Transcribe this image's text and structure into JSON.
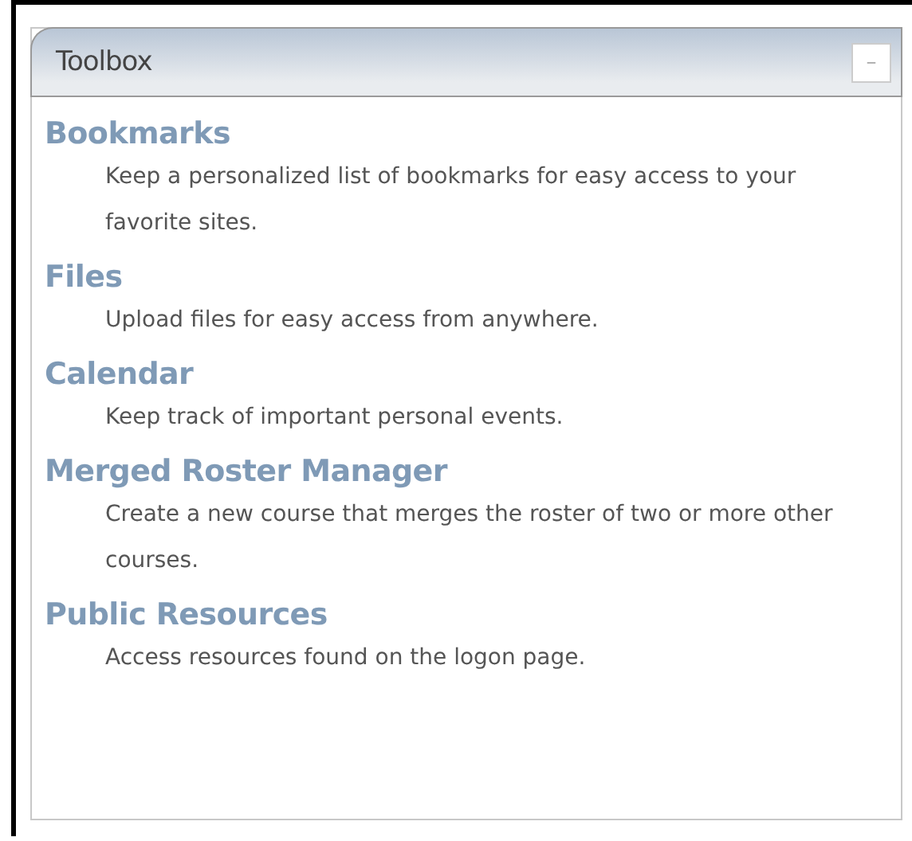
{
  "panel": {
    "title": "Toolbox",
    "collapse_button": "–"
  },
  "tools": [
    {
      "name": "Bookmarks",
      "description": "Keep a personalized list of bookmarks for easy access to your favorite sites."
    },
    {
      "name": "Files",
      "description": "Upload files for easy access from anywhere."
    },
    {
      "name": "Calendar",
      "description": "Keep track of important personal events."
    },
    {
      "name": "Merged Roster Manager",
      "description": "Create a new course that merges the roster of two or more other courses."
    },
    {
      "name": "Public Resources",
      "description": "Access resources found on the logon page."
    }
  ]
}
